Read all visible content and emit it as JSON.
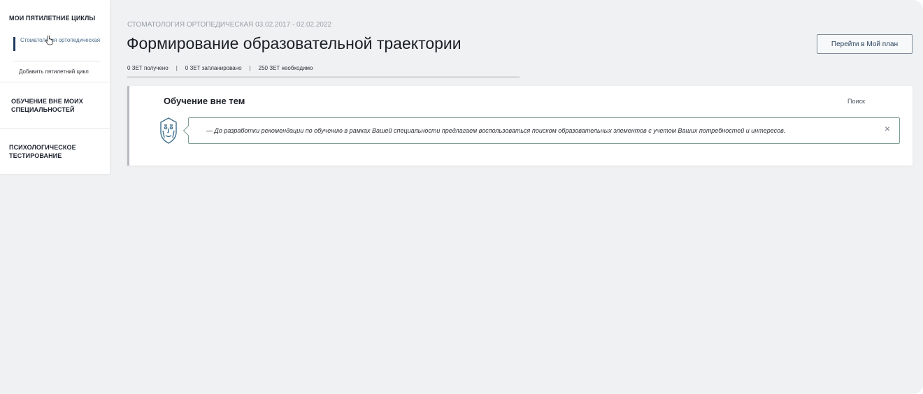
{
  "sidebar": {
    "my_cycles_heading": "МОИ ПЯТИЛЕТНИЕ ЦИКЛЫ",
    "cycle_item": "Стоматология ортопедическая",
    "add_cycle": "Добавить пятилетний цикл",
    "outside_specialties": "ОБУЧЕНИЕ ВНЕ МОИХ СПЕЦИАЛЬНОСТЕЙ",
    "psych_testing": "ПСИХОЛОГИЧЕСКОЕ ТЕСТИРОВАНИЕ"
  },
  "header": {
    "breadcrumb": "СТОМАТОЛОГИЯ ОРТОПЕДИЧЕСКАЯ 03.02.2017 - 02.02.2022",
    "title": "Формирование образовательной траектории",
    "stats": {
      "received": "0 ЗЕТ получено",
      "planned": "0 ЗЕТ запланировано",
      "required": "250 ЗЕТ необходимо"
    },
    "plan_button": "Перейти в Мой план"
  },
  "card": {
    "title": "Обучение вне тем",
    "search_label": "Поиск",
    "message": "— До разработки рекомендации по обучению в рамках Вашей специальности предлагаем воспользоваться поиском образовательных элементов с учетом Ваших потребностей и интересов.",
    "close_symbol": "×"
  },
  "icons": {
    "assistant": "assistant-face-icon",
    "close": "close-icon",
    "cursor": "hand-cursor-icon"
  },
  "colors": {
    "accent": "#1f3b5c",
    "message_border": "#7fa090",
    "background": "#f0f1f3"
  }
}
